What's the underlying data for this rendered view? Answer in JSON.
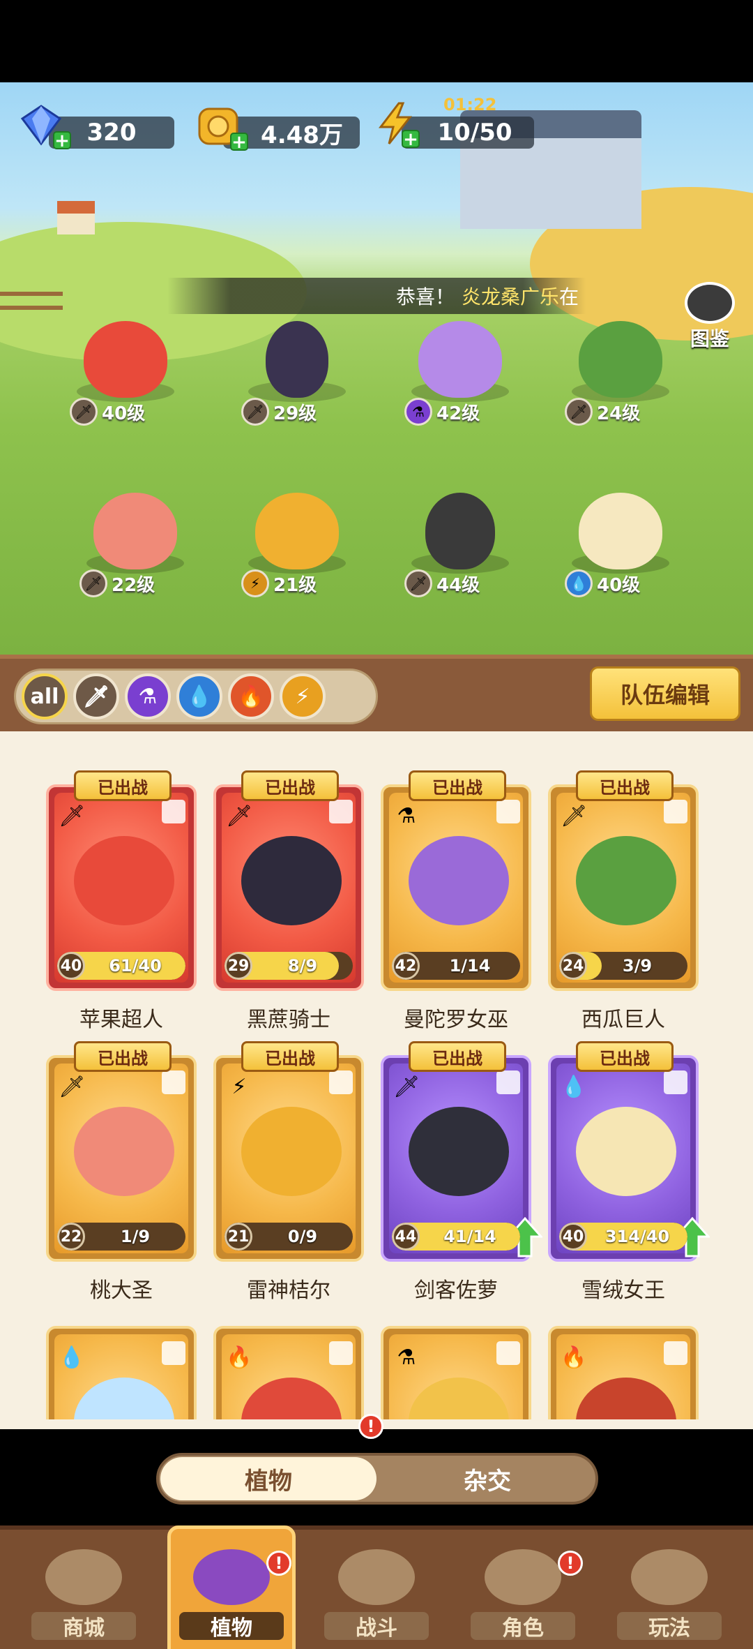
{
  "resources": {
    "gems": "320",
    "coins": "4.48万",
    "energy": "10/50",
    "energy_timer": "01:22"
  },
  "banner": {
    "text": "恭喜！",
    "highlight": "炎龙桑广乐",
    "suffix": "在"
  },
  "codex_label": "图鉴",
  "field_units": [
    {
      "level": "40级",
      "element": "sword-icon",
      "color": "#e84a3a"
    },
    {
      "level": "29级",
      "element": "sword-icon",
      "color": "#3a3350"
    },
    {
      "level": "42级",
      "element": "potion-icon",
      "color": "#b58ae8"
    },
    {
      "level": "24级",
      "element": "sword-icon",
      "color": "#5aa040"
    },
    {
      "level": "22级",
      "element": "sword-icon",
      "color": "#f08a78"
    },
    {
      "level": "21级",
      "element": "lightning-icon",
      "color": "#f0b030"
    },
    {
      "level": "44级",
      "element": "sword-icon",
      "color": "#3a3a3a"
    },
    {
      "level": "40级",
      "element": "water-icon",
      "color": "#f6e8c0"
    }
  ],
  "filters": [
    "all",
    "sword",
    "potion",
    "water",
    "fire",
    "lightning"
  ],
  "filter_all_label": "all",
  "team_edit": "队伍编辑",
  "deployed_label": "已出战",
  "cards": [
    {
      "name": "苹果超人",
      "level": "40",
      "progress": "61/40",
      "fill": 1.0,
      "rarity": "red",
      "element": "sword",
      "color": "#e84a3a"
    },
    {
      "name": "黑蔗骑士",
      "level": "29",
      "progress": "8/9",
      "fill": 0.89,
      "rarity": "red",
      "element": "sword",
      "color": "#2e2a3c"
    },
    {
      "name": "曼陀罗女巫",
      "level": "42",
      "progress": "1/14",
      "fill": 0.07,
      "rarity": "gold",
      "element": "potion",
      "color": "#9a6ad8"
    },
    {
      "name": "西瓜巨人",
      "level": "24",
      "progress": "3/9",
      "fill": 0.33,
      "rarity": "gold",
      "element": "sword",
      "color": "#5aa040"
    },
    {
      "name": "桃大圣",
      "level": "22",
      "progress": "1/9",
      "fill": 0.11,
      "rarity": "gold",
      "element": "sword",
      "color": "#f08a78"
    },
    {
      "name": "雷神桔尔",
      "level": "21",
      "progress": "0/9",
      "fill": 0.0,
      "rarity": "gold",
      "element": "lightning",
      "color": "#f0b030"
    },
    {
      "name": "剑客佐萝",
      "level": "44",
      "progress": "41/14",
      "fill": 1.0,
      "rarity": "purple",
      "element": "sword",
      "color": "#2f2f3a"
    },
    {
      "name": "雪绒女王",
      "level": "40",
      "progress": "314/40",
      "fill": 1.0,
      "rarity": "purple",
      "element": "water",
      "color": "#f6e6b4"
    }
  ],
  "partial_cards": [
    {
      "element": "water",
      "color": "#bfe4ff"
    },
    {
      "element": "fire",
      "color": "#e04a3a"
    },
    {
      "element": "potion",
      "color": "#f2c24a"
    },
    {
      "element": "fire",
      "color": "#c8442c"
    }
  ],
  "toggle": {
    "left": "植物",
    "right": "杂交",
    "badge": "!"
  },
  "nav": [
    {
      "label": "商城",
      "badge": ""
    },
    {
      "label": "植物",
      "badge": "!"
    },
    {
      "label": "战斗",
      "badge": ""
    },
    {
      "label": "角色",
      "badge": "!"
    },
    {
      "label": "玩法",
      "badge": ""
    }
  ],
  "colors": {
    "accent": "#f4c13a",
    "wood": "#8a5a3a",
    "panel": "#f7f0e1"
  }
}
